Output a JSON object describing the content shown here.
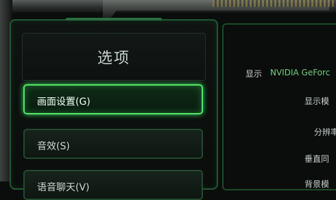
{
  "left_panel": {
    "title": "选项",
    "menu": [
      {
        "label": "画面设置(G)",
        "selected": true
      },
      {
        "label": "音效(S)",
        "selected": false
      },
      {
        "label": "语音聊天(V)",
        "selected": false
      }
    ]
  },
  "right_panel": {
    "display_label": "显示",
    "display_value": "NVIDIA GeForc",
    "settings": [
      {
        "label": "显示模"
      },
      {
        "label": "分辨率"
      },
      {
        "label": "垂直同"
      },
      {
        "label": "背景模"
      }
    ]
  },
  "colors": {
    "accent_green": "#55e66a",
    "panel_border": "#1f5a33",
    "value_green": "#6fd07a"
  }
}
